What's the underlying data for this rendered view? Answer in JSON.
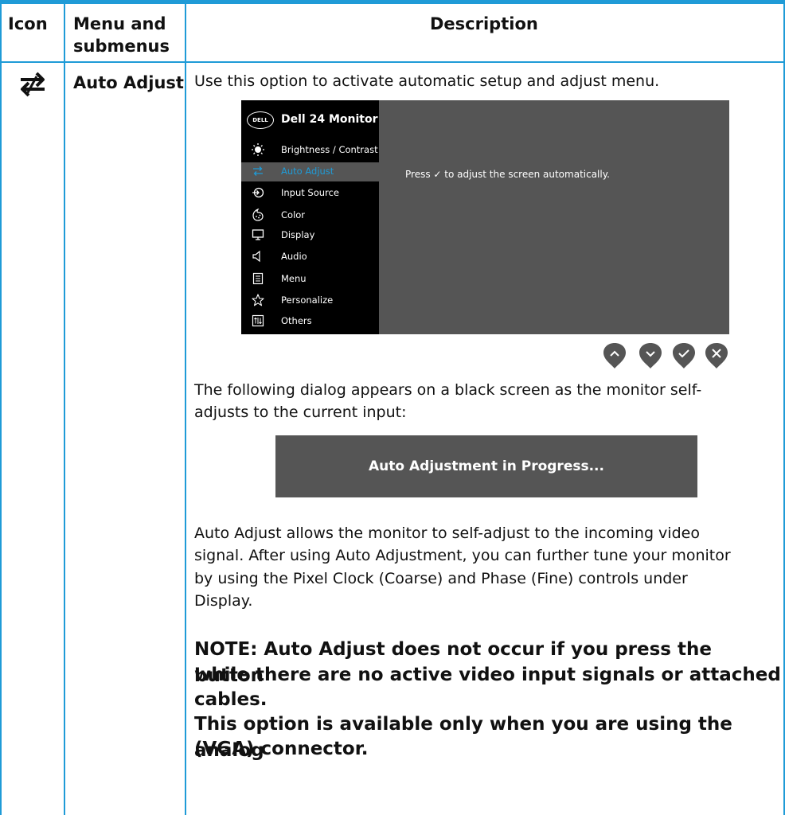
{
  "header": {
    "col_icon": "Icon",
    "col_menu_line1": "Menu and",
    "col_menu_line2": "submenus",
    "col_desc": "Description"
  },
  "row": {
    "icon": "auto-adjust-icon",
    "menu_label": "Auto Adjust",
    "intro": "Use this option to activate automatic setup and adjust menu.",
    "dialog_intro_line1": "The following dialog appears on a black screen as the monitor self-",
    "dialog_intro_line2": "adjusts to the current input:",
    "progress_text": "Auto Adjustment in Progress...",
    "para_line1": "Auto Adjust allows the monitor to self-adjust to the incoming video",
    "para_line2": "signal. After using Auto Adjustment, you can further tune your monitor",
    "para_line3": "by using the Pixel Clock (Coarse) and Phase (Fine) controls under",
    "para_line4": "Display.",
    "note_line1": "NOTE: Auto Adjust does not occur if you press the button",
    "note_line2": "while there are no active video input signals or attached",
    "note_line3": "cables.",
    "note_line4": "This option is available only when you are using the analog",
    "note_line5": "(VGA) connector."
  },
  "osd": {
    "logo": "DELL",
    "title": "Dell 24 Monitor",
    "message": "Press ✓ to adjust the screen automatically.",
    "items": [
      {
        "label": "Brightness / Contrast",
        "icon": "brightness-icon"
      },
      {
        "label": "Auto Adjust",
        "icon": "auto-adjust-icon",
        "active": true
      },
      {
        "label": "Input Source",
        "icon": "input-source-icon"
      },
      {
        "label": "Color",
        "icon": "color-icon"
      },
      {
        "label": "Display",
        "icon": "display-icon"
      },
      {
        "label": "Audio",
        "icon": "audio-icon"
      },
      {
        "label": "Menu",
        "icon": "menu-icon"
      },
      {
        "label": "Personalize",
        "icon": "personalize-icon"
      },
      {
        "label": "Others",
        "icon": "others-icon"
      }
    ],
    "buttons": [
      "up-button-icon",
      "down-button-icon",
      "check-button-icon",
      "close-button-icon"
    ]
  },
  "colors": {
    "border": "#1f9bd7",
    "osd_panel": "#555555",
    "osd_sidebar": "#000000",
    "accent": "#1f9bd7"
  }
}
